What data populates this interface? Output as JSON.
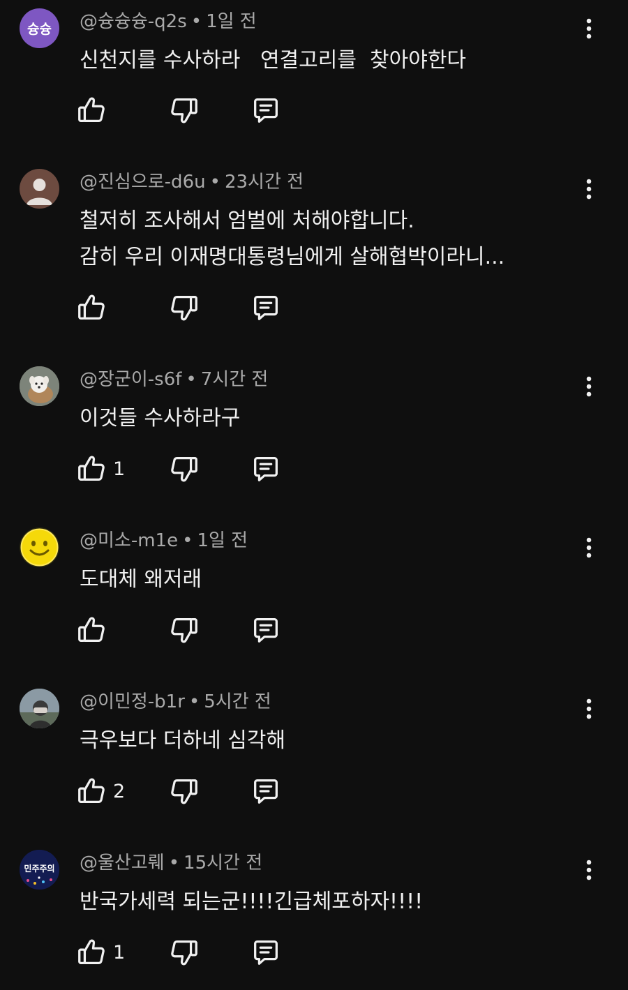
{
  "comments": [
    {
      "author": "@슝슝슝-q2s",
      "time": "1일 전",
      "lines": [
        "신천지를 수사하라   연결고리를  찾아야한다"
      ],
      "likes": "",
      "avatar_letters": "슝슝",
      "avatar_color": "#7e57c2"
    },
    {
      "author": "@진심으로-d6u",
      "time": "23시간 전",
      "lines": [
        "철저히 조사해서 엄벌에 처해야합니다.",
        "감히 우리 이재명대통령님에게 살해협박이라니..."
      ],
      "likes": "",
      "avatar_icon": "default-person-avatar"
    },
    {
      "author": "@장군이-s6f",
      "time": "7시간 전",
      "lines": [
        "이것들 수사하라구"
      ],
      "likes": "1",
      "avatar_icon": "dog-photo-avatar"
    },
    {
      "author": "@미소-m1e",
      "time": "1일 전",
      "lines": [
        "도대체 왜저래"
      ],
      "likes": "",
      "avatar_icon": "smiley-face-avatar"
    },
    {
      "author": "@이민정-b1r",
      "time": "5시간 전",
      "lines": [
        "극우보다 더하네 심각해"
      ],
      "likes": "2",
      "avatar_icon": "person-photo-avatar"
    },
    {
      "author": "@울산고뤠",
      "time": "15시간 전",
      "lines": [
        "반국가세력 되는군!!!!긴급체포하자!!!!"
      ],
      "likes": "1",
      "avatar_icon": "protest-badge-avatar",
      "avatar_text": "민주주의"
    }
  ],
  "meta_separator": "•",
  "colors": {
    "background": "#0f0f0f",
    "text": "#f1f1f1",
    "meta": "#aaaaaa"
  }
}
